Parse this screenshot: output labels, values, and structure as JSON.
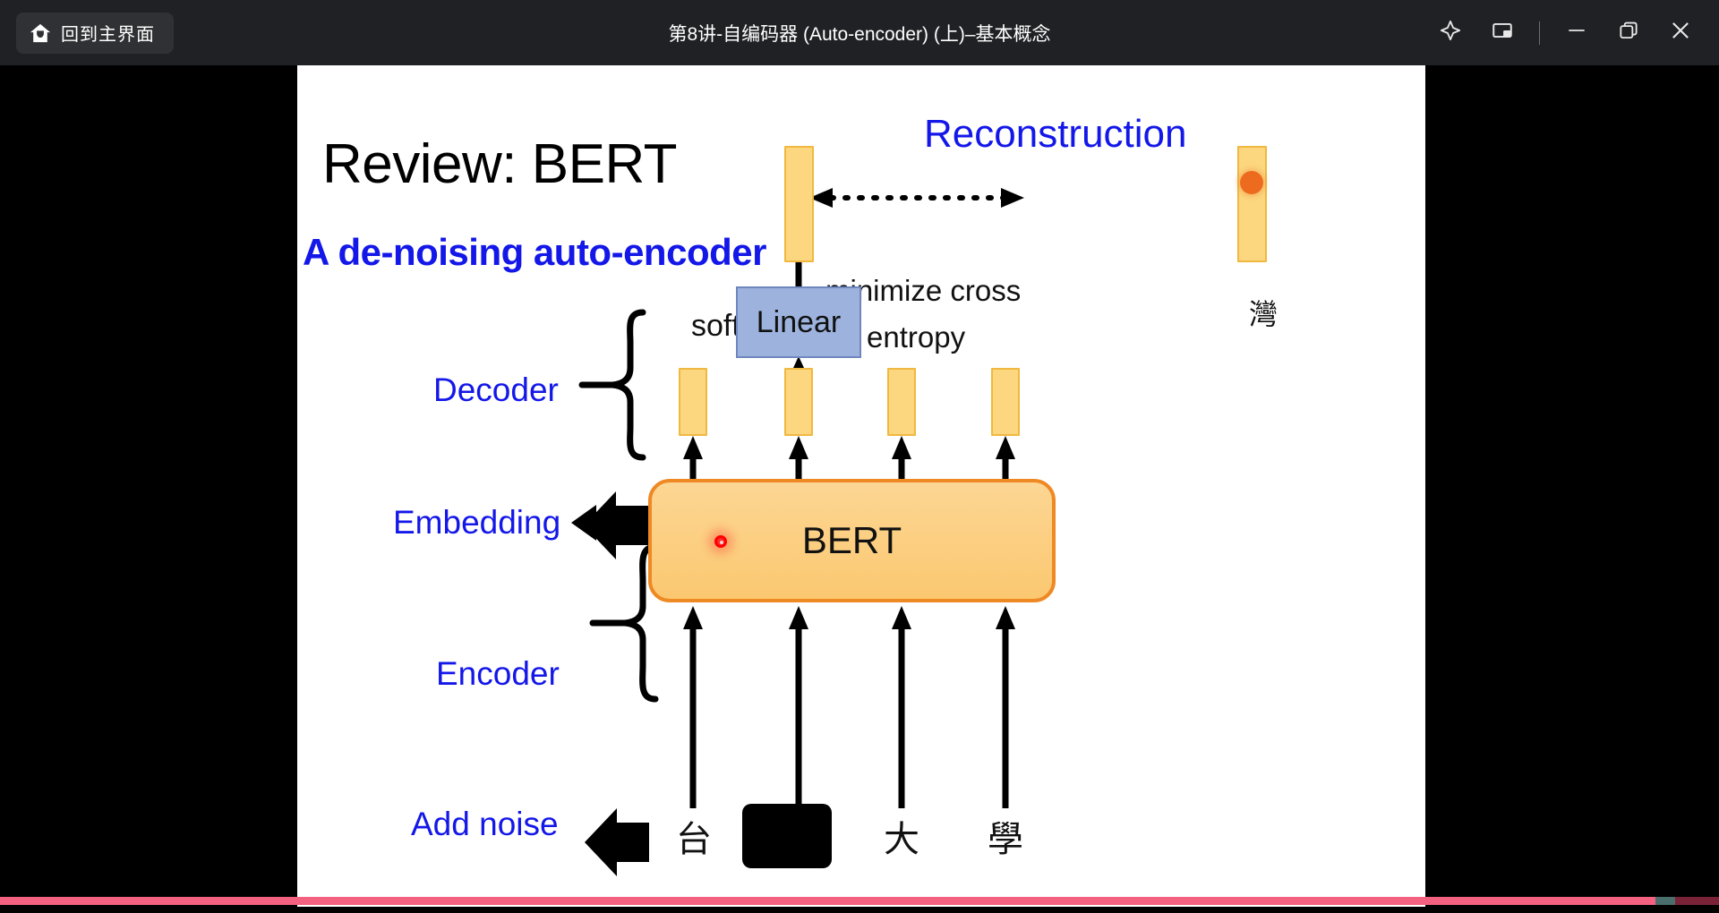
{
  "window": {
    "title": "第8讲-自编码器 (Auto-encoder) (上)–基本概念",
    "home_button_label": "回到主界面",
    "home_icon": "home-icon",
    "controls": [
      {
        "name": "pin-icon",
        "label": "置顶"
      },
      {
        "name": "picture-in-picture-icon",
        "label": "小窗播放"
      },
      {
        "name": "minimize-icon",
        "label": "最小化"
      },
      {
        "name": "restore-icon",
        "label": "还原"
      },
      {
        "name": "close-icon",
        "label": "关闭"
      }
    ],
    "titlebar_color": "#1F2124",
    "letterbox_color": "#000000"
  },
  "player": {
    "progress_percent": 96.5,
    "progress_color": "#F4607F",
    "progress_track_color": "#7A2338",
    "knob_color": "#4A6E6B"
  },
  "slide": {
    "background": "#FFFFFF",
    "heading": "Review: BERT",
    "subheading": "A de-noising auto-encoder",
    "accent_blue": "#1317E8",
    "labels": {
      "reconstruction": "Reconstruction",
      "softmax": "softmax",
      "minimize_cross": "minimize cross",
      "entropy": "entropy",
      "decoder": "Decoder",
      "embedding": "Embedding",
      "encoder": "Encoder",
      "add_noise": "Add noise",
      "linear": "Linear",
      "bert": "BERT",
      "reconstruction_token": "灣"
    },
    "input_tokens": [
      {
        "text": "台",
        "masked": false
      },
      {
        "text": "",
        "masked": true
      },
      {
        "text": "大",
        "masked": false
      },
      {
        "text": "學",
        "masked": false
      }
    ],
    "embedding_bars": 4,
    "bar_fill": "#FCD77F",
    "bar_stroke": "#F0B840",
    "linear_fill": "#9DB3DE",
    "bert_fill": "#FBC870",
    "bert_stroke": "#EE8924",
    "marker_dot_color": "#ED6B1F",
    "laser_pointer_color": "#FF0000"
  }
}
